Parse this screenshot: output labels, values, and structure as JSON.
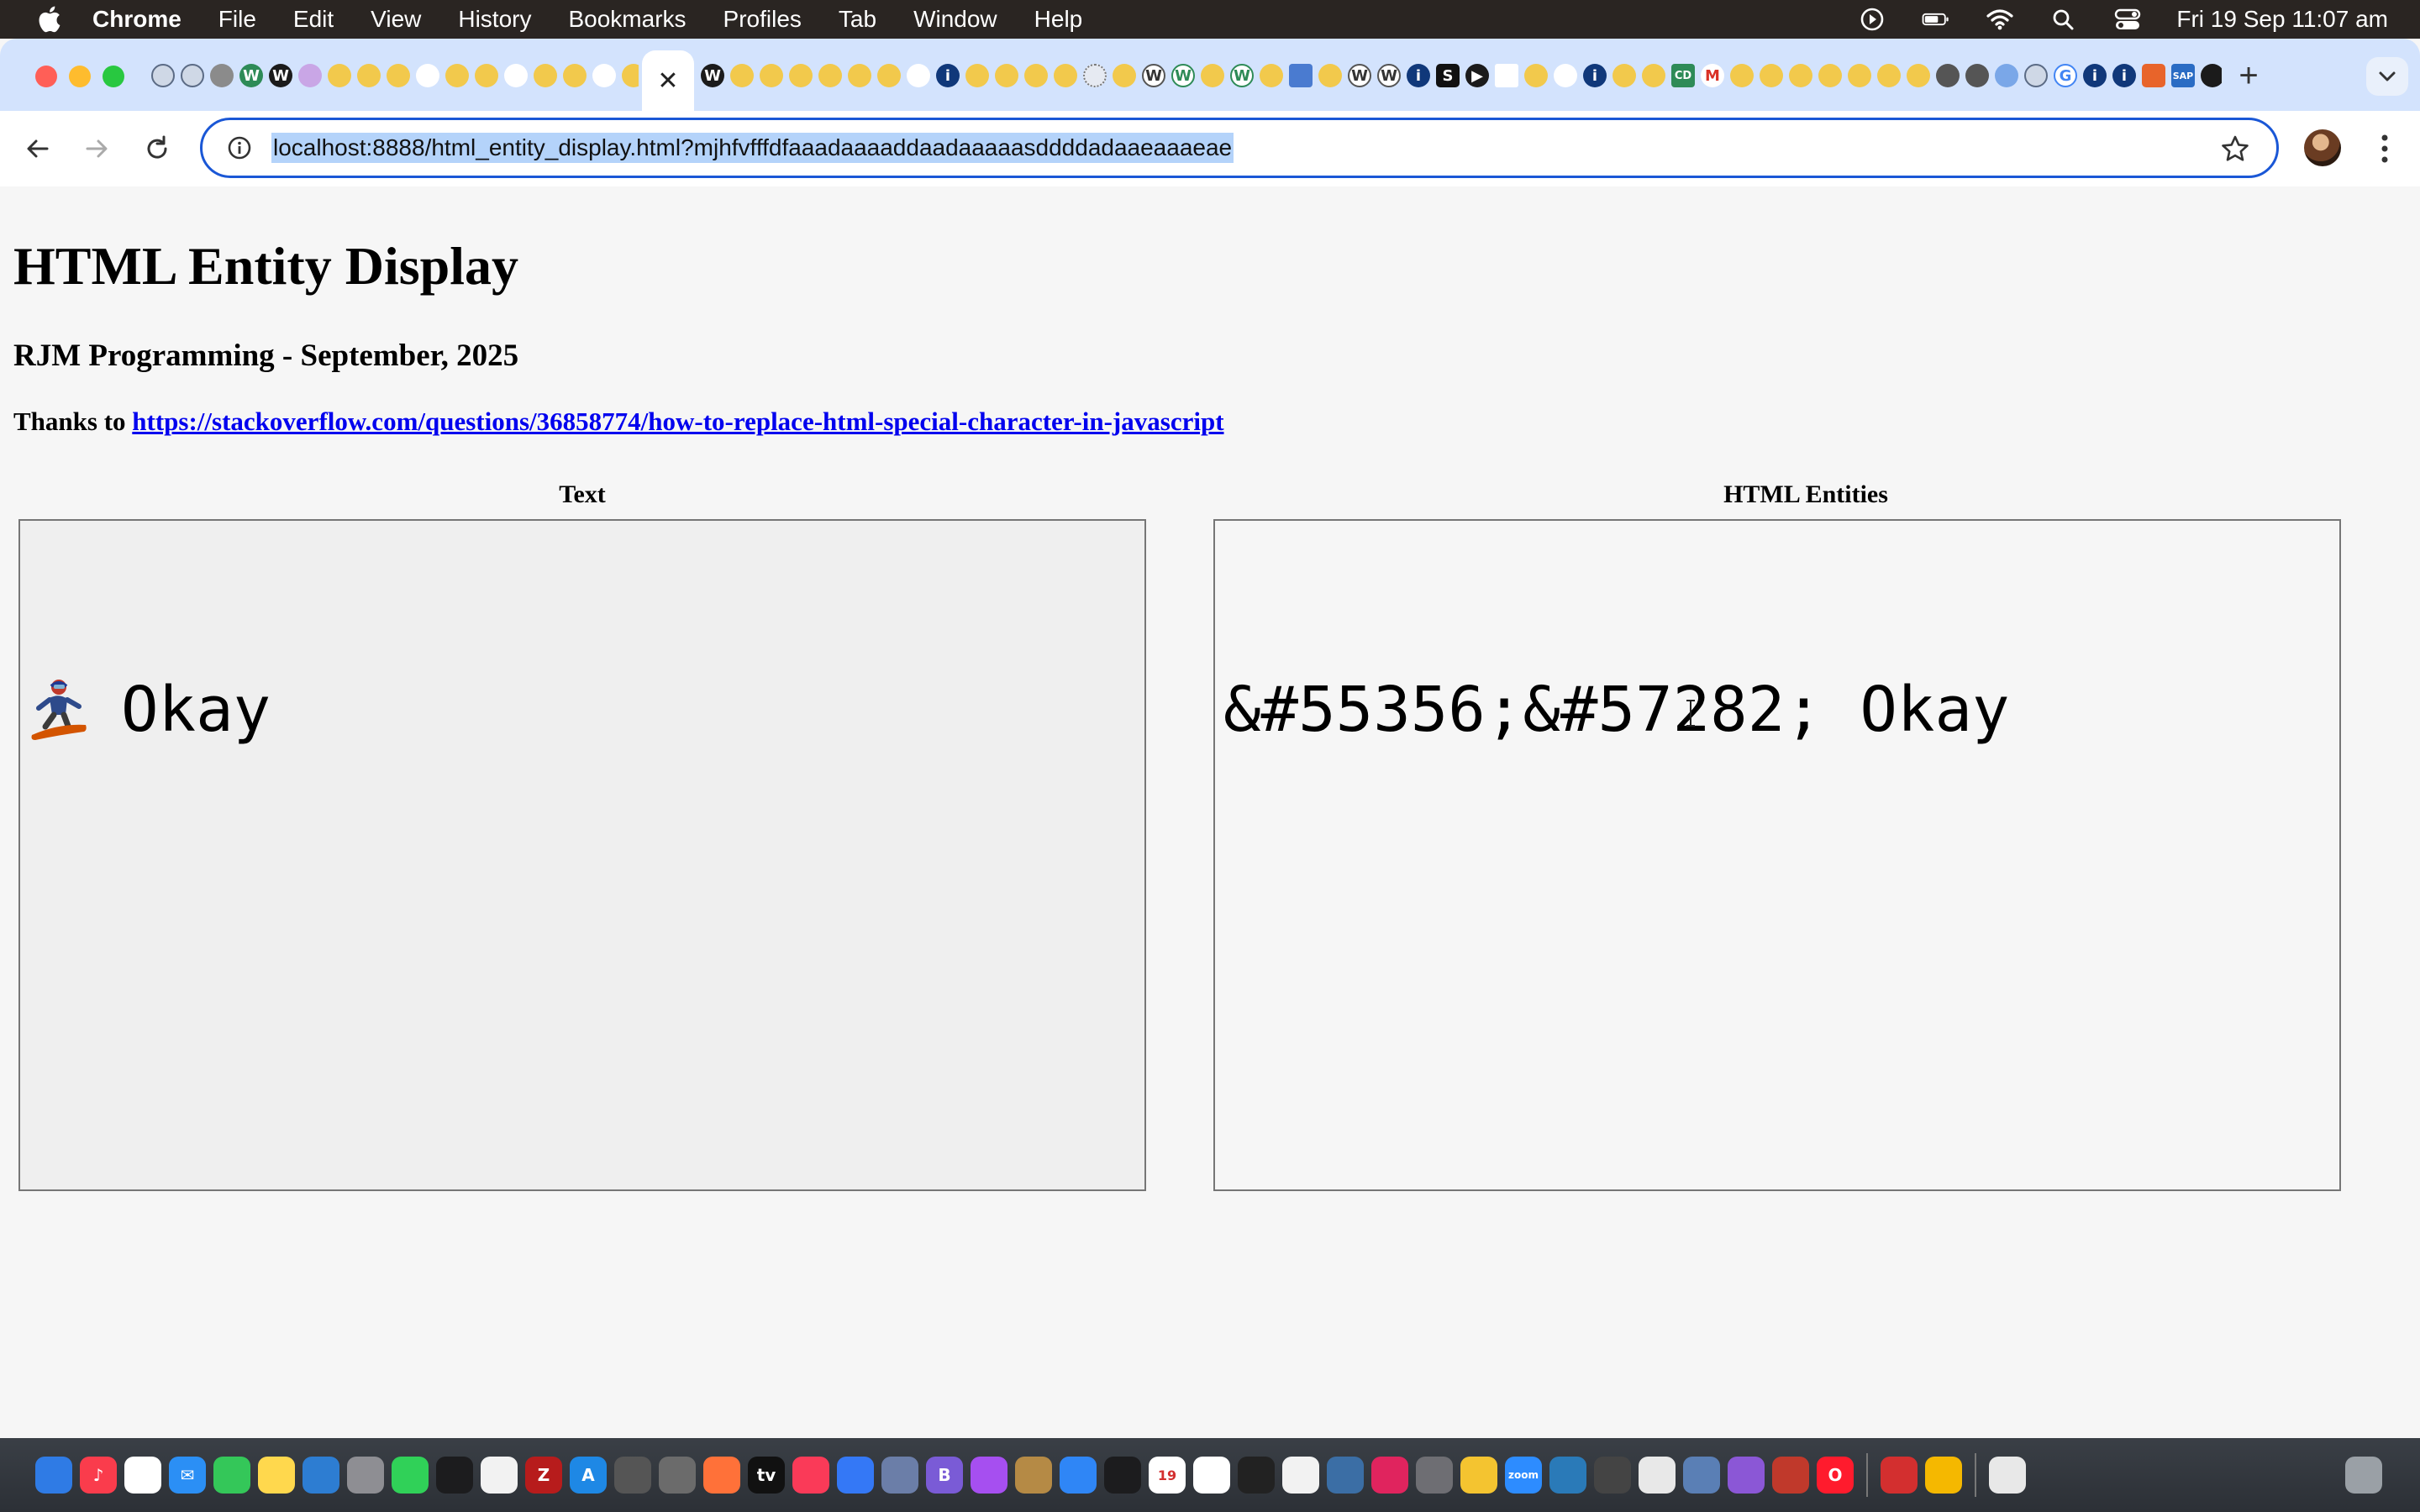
{
  "menubar": {
    "app_name": "Chrome",
    "items": [
      "File",
      "Edit",
      "View",
      "History",
      "Bookmarks",
      "Profiles",
      "Tab",
      "Window",
      "Help"
    ],
    "clock": "Fri 19 Sep  11:07 am"
  },
  "browser": {
    "active_tab_close": "✕",
    "new_tab": "+",
    "url": "localhost:8888/html_entity_display.html?mjhfvfffdfaaadaaaaddaadaaaaasddddadaaeaaaeae"
  },
  "page": {
    "title": "HTML Entity Display",
    "subtitle": "RJM Programming - September, 2025",
    "thanks_prefix": "Thanks to ",
    "thanks_link": "https://stackoverflow.com/questions/36858774/how-to-replace-html-special-character-in-javascript",
    "text_label": "Text",
    "entities_label": "HTML Entities",
    "text_value": "Okay",
    "entities_value": "&#55356;&#57282; Okay"
  },
  "colors": {
    "accent_blue": "#1a57d6",
    "tabstrip": "#d3e3fd",
    "link": "#0000ee"
  }
}
